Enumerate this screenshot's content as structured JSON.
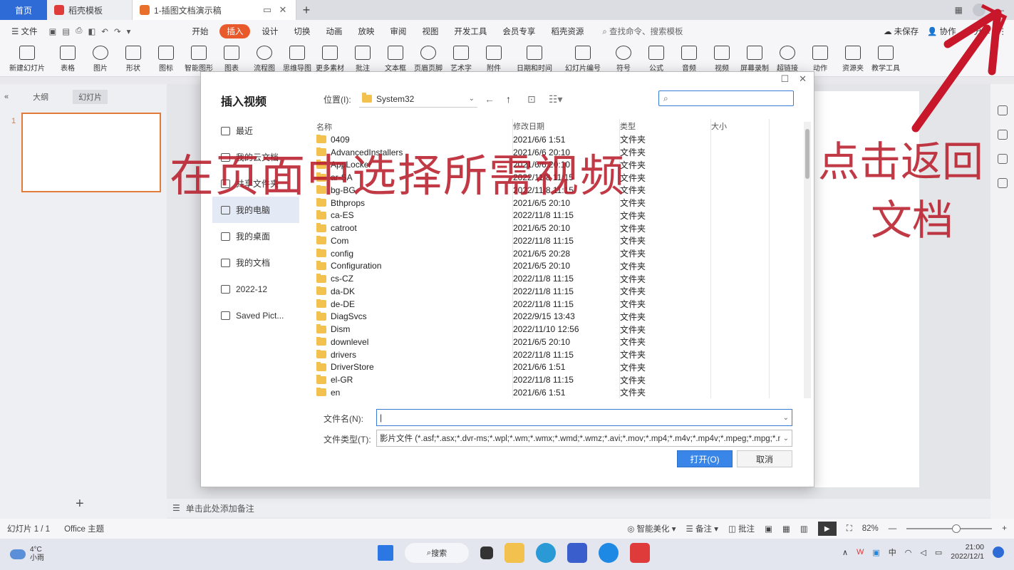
{
  "tabs": {
    "home": "首页",
    "template": "稻壳模板",
    "document": "1-插图文档演示稿"
  },
  "menu": {
    "file": "文件",
    "items": [
      "开始",
      "插入",
      "设计",
      "切换",
      "动画",
      "放映",
      "审阅",
      "视图",
      "开发工具",
      "会员专享",
      "稻壳资源"
    ],
    "active_index": 1,
    "search": "查找命令、搜索模板",
    "right": [
      "未保存",
      "协作",
      "分享"
    ]
  },
  "ribbon": [
    "新建幻灯片",
    "表格",
    "图片",
    "形状",
    "图标",
    "智能图形",
    "图表",
    "流程图",
    "思维导图",
    "更多素材",
    "批注",
    "文本框",
    "页眉页脚",
    "艺术字",
    "附件",
    "日期和时间",
    "幻灯片编号",
    "符号",
    "公式",
    "音频",
    "视频",
    "屏幕录制",
    "超链接",
    "动作",
    "资源夹",
    "教学工具"
  ],
  "left_panel": {
    "tab_outline": "大纲",
    "tab_slides": "幻灯片",
    "slide_number": "1"
  },
  "notes_placeholder": "单击此处添加备注",
  "status": {
    "slide_count": "幻灯片 1 / 1",
    "theme": "Office 主题",
    "smart_beautify": "智能美化",
    "notes": "备注",
    "comments": "批注",
    "zoom": "82%"
  },
  "dialog": {
    "title": "插入视频",
    "location_label": "位置(I):",
    "location_value": "System32",
    "search_placeholder": "",
    "sidebar": [
      "最近",
      "我的云文档",
      "共享文件夹",
      "我的电脑",
      "我的桌面",
      "我的文档",
      "2022-12",
      "Saved Pict..."
    ],
    "sidebar_active_index": 3,
    "columns": [
      "名称",
      "修改日期",
      "类型",
      "大小"
    ],
    "files": [
      {
        "name": "0409",
        "date": "2021/6/6 1:51",
        "type": "文件夹"
      },
      {
        "name": "AdvancedInstallers",
        "date": "2021/6/6 20:10",
        "type": "文件夹"
      },
      {
        "name": "AppLocker",
        "date": "2021/6/6 20:10",
        "type": "文件夹"
      },
      {
        "name": "ar-SA",
        "date": "2022/11/8 11:15",
        "type": "文件夹"
      },
      {
        "name": "bg-BG",
        "date": "2022/11/8 11:15",
        "type": "文件夹"
      },
      {
        "name": "Bthprops",
        "date": "2021/6/5 20:10",
        "type": "文件夹"
      },
      {
        "name": "ca-ES",
        "date": "2022/11/8 11:15",
        "type": "文件夹"
      },
      {
        "name": "catroot",
        "date": "2021/6/5 20:10",
        "type": "文件夹"
      },
      {
        "name": "Com",
        "date": "2022/11/8 11:15",
        "type": "文件夹"
      },
      {
        "name": "config",
        "date": "2021/6/5 20:28",
        "type": "文件夹"
      },
      {
        "name": "Configuration",
        "date": "2021/6/5 20:10",
        "type": "文件夹"
      },
      {
        "name": "cs-CZ",
        "date": "2022/11/8 11:15",
        "type": "文件夹"
      },
      {
        "name": "da-DK",
        "date": "2022/11/8 11:15",
        "type": "文件夹"
      },
      {
        "name": "de-DE",
        "date": "2022/11/8 11:15",
        "type": "文件夹"
      },
      {
        "name": "DiagSvcs",
        "date": "2022/9/15 13:43",
        "type": "文件夹"
      },
      {
        "name": "Dism",
        "date": "2022/11/10 12:56",
        "type": "文件夹"
      },
      {
        "name": "downlevel",
        "date": "2021/6/5 20:10",
        "type": "文件夹"
      },
      {
        "name": "drivers",
        "date": "2022/11/8 11:15",
        "type": "文件夹"
      },
      {
        "name": "DriverStore",
        "date": "2021/6/6 1:51",
        "type": "文件夹"
      },
      {
        "name": "el-GR",
        "date": "2022/11/8 11:15",
        "type": "文件夹"
      },
      {
        "name": "en",
        "date": "2021/6/6 1:51",
        "type": "文件夹"
      }
    ],
    "filename_label": "文件名(N):",
    "filename_value": "|",
    "filetype_label": "文件类型(T):",
    "filetype_value": "影片文件 (*.asf;*.asx;*.dvr-ms;*.wpl;*.wm;*.wmx;*.wmd;*.wmz;*.avi;*.mov;*.mp4;*.m4v;*.mp4v;*.mpeg;*.mpg;*.m",
    "open_button": "打开(O)",
    "cancel_button": "取消"
  },
  "annotations": {
    "select_video": "在页面中选择所需视频",
    "click_return_1": "点击返回",
    "click_return_2": "文档"
  },
  "taskbar": {
    "temperature": "4°C",
    "weather": "小雨",
    "search": "搜索",
    "ime": "中",
    "time": "21:00",
    "date": "2022/12/1"
  },
  "colors": {
    "accent": "#2f6bd6",
    "insert_tab": "#e85a2b",
    "annotation": "#b81e2c",
    "slide_border": "#e27a3a"
  }
}
